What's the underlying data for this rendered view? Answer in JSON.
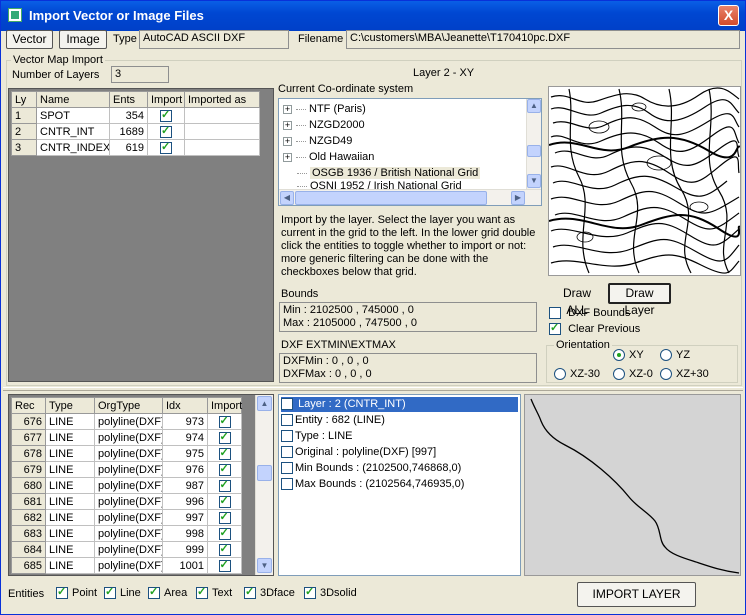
{
  "window": {
    "title": "Import Vector or Image Files",
    "close": "X"
  },
  "toolbar": {
    "vector_label": "Vector",
    "image_label": "Image",
    "type_label": "Type",
    "type_value": "AutoCAD ASCII DXF",
    "filename_label": "Filename",
    "filename_value": "C:\\customers\\MBA\\Jeanette\\T170410pc.DXF"
  },
  "vector_group": {
    "title": "Vector Map Import",
    "num_layers_label": "Number of Layers",
    "num_layers": "3",
    "layer_heading": "Layer 2 - XY"
  },
  "layers": {
    "headers": [
      "Ly",
      "Name",
      "Ents",
      "Import",
      "Imported as"
    ],
    "rows": [
      {
        "ly": "1",
        "name": "SPOT",
        "ents": "354",
        "import": true,
        "as": ""
      },
      {
        "ly": "2",
        "name": "CNTR_INT",
        "ents": "1689",
        "import": true,
        "as": ""
      },
      {
        "ly": "3",
        "name": "CNTR_INDEX",
        "ents": "619",
        "import": true,
        "as": ""
      }
    ]
  },
  "coord": {
    "label": "Current Co-ordinate system",
    "items": [
      "NTF (Paris)",
      "NZGD2000",
      "NZGD49",
      "Old Hawaiian",
      "OSGB 1936 / British National Grid",
      "OSNI 1952 / Irish National Grid"
    ],
    "selected": 4
  },
  "instructions": "Import by the layer. Select the layer you want as current in the grid to the left. In the lower grid double click the entities to toggle whether to import or not: more generic filtering can be done with the checkboxes below that grid.",
  "bounds": {
    "label": "Bounds",
    "min": "Min : 2102500 , 745000 , 0",
    "max": "Max : 2105000 , 747500 , 0"
  },
  "extents": {
    "label": "DXF EXTMIN\\EXTMAX",
    "min": "DXFMin : 0 , 0 , 0",
    "max": "DXFMax : 0 , 0 , 0"
  },
  "preview_buttons": {
    "draw_all": "Draw ALL",
    "draw_layer": "Draw Layer"
  },
  "options": {
    "dxf_bounds": "DXF Bounds",
    "dxf_bounds_checked": false,
    "clear_previous": "Clear Previous",
    "clear_previous_checked": true
  },
  "orientation": {
    "label": "Orientation",
    "options": [
      "XY",
      "YZ",
      "XZ-30",
      "XZ-0",
      "XZ+30"
    ],
    "selected": "XY"
  },
  "entities": {
    "headers": [
      "Rec",
      "Type",
      "OrgType",
      "Idx",
      "Import"
    ],
    "rows": [
      {
        "rec": "676",
        "type": "LINE",
        "org": "polyline(DXF)",
        "idx": "973",
        "import": true
      },
      {
        "rec": "677",
        "type": "LINE",
        "org": "polyline(DXF)",
        "idx": "974",
        "import": true
      },
      {
        "rec": "678",
        "type": "LINE",
        "org": "polyline(DXF)",
        "idx": "975",
        "import": true
      },
      {
        "rec": "679",
        "type": "LINE",
        "org": "polyline(DXF)",
        "idx": "976",
        "import": true
      },
      {
        "rec": "680",
        "type": "LINE",
        "org": "polyline(DXF)",
        "idx": "987",
        "import": true
      },
      {
        "rec": "681",
        "type": "LINE",
        "org": "polyline(DXF)",
        "idx": "996",
        "import": true
      },
      {
        "rec": "682",
        "type": "LINE",
        "org": "polyline(DXF)",
        "idx": "997",
        "import": true
      },
      {
        "rec": "683",
        "type": "LINE",
        "org": "polyline(DXF)",
        "idx": "998",
        "import": true
      },
      {
        "rec": "684",
        "type": "LINE",
        "org": "polyline(DXF)",
        "idx": "999",
        "import": true
      },
      {
        "rec": "685",
        "type": "LINE",
        "org": "polyline(DXF)",
        "idx": "1001",
        "import": true
      }
    ]
  },
  "details": [
    "Layer : 2 (CNTR_INT)",
    "Entity : 682 (LINE)",
    "Type : LINE",
    "Original : polyline(DXF) [997]",
    "Min Bounds : (2102500,746868,0)",
    "Max Bounds : (2102564,746935,0)"
  ],
  "filters": {
    "label": "Entities",
    "items": [
      {
        "label": "Point",
        "checked": true
      },
      {
        "label": "Line",
        "checked": true
      },
      {
        "label": "Area",
        "checked": true
      },
      {
        "label": "Text",
        "checked": true
      },
      {
        "label": "3Dface",
        "checked": true
      },
      {
        "label": "3Dsolid",
        "checked": true
      }
    ]
  },
  "import_button": "IMPORT LAYER"
}
